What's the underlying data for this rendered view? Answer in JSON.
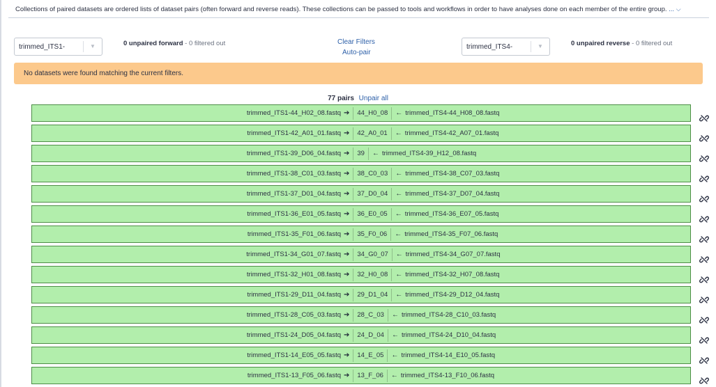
{
  "intro": {
    "text": "Collections of paired datasets are ordered lists of dataset pairs (often forward and reverse reads). These collections can be passed to tools and workflows in order to have analyses done on each member of the entire group.",
    "more": "...",
    "chevron_icon": "chevron-down-icon"
  },
  "forward": {
    "filter_value": "trimmed_ITS1-",
    "count_bold": "0 unpaired forward",
    "count_rest": " - 0 filtered out"
  },
  "reverse": {
    "filter_value": "trimmed_ITS4-",
    "count_bold": "0 unpaired reverse",
    "count_rest": " - 0 filtered out"
  },
  "actions": {
    "clear_filters": "Clear Filters",
    "auto_pair": "Auto-pair"
  },
  "warning": "No datasets were found matching the current filters.",
  "pairs_header": {
    "count": "77 pairs",
    "unpair_all": "Unpair all"
  },
  "colors": {
    "pair_bg": "#b2eeac",
    "pair_border": "#4d8e46",
    "warning_bg": "#fcc98c",
    "link": "#2c5fa8"
  },
  "pairs": [
    {
      "forward": "trimmed_ITS1-44_H02_08.fastq",
      "name": "44_H0_08",
      "reverse": "trimmed_ITS4-44_H08_08.fastq"
    },
    {
      "forward": "trimmed_ITS1-42_A01_01.fastq",
      "name": "42_A0_01",
      "reverse": "trimmed_ITS4-42_A07_01.fastq"
    },
    {
      "forward": "trimmed_ITS1-39_D06_04.fastq",
      "name": "39",
      "reverse": "trimmed_ITS4-39_H12_08.fastq"
    },
    {
      "forward": "trimmed_ITS1-38_C01_03.fastq",
      "name": "38_C0_03",
      "reverse": "trimmed_ITS4-38_C07_03.fastq"
    },
    {
      "forward": "trimmed_ITS1-37_D01_04.fastq",
      "name": "37_D0_04",
      "reverse": "trimmed_ITS4-37_D07_04.fastq"
    },
    {
      "forward": "trimmed_ITS1-36_E01_05.fastq",
      "name": "36_E0_05",
      "reverse": "trimmed_ITS4-36_E07_05.fastq"
    },
    {
      "forward": "trimmed_ITS1-35_F01_06.fastq",
      "name": "35_F0_06",
      "reverse": "trimmed_ITS4-35_F07_06.fastq"
    },
    {
      "forward": "trimmed_ITS1-34_G01_07.fastq",
      "name": "34_G0_07",
      "reverse": "trimmed_ITS4-34_G07_07.fastq"
    },
    {
      "forward": "trimmed_ITS1-32_H01_08.fastq",
      "name": "32_H0_08",
      "reverse": "trimmed_ITS4-32_H07_08.fastq"
    },
    {
      "forward": "trimmed_ITS1-29_D11_04.fastq",
      "name": "29_D1_04",
      "reverse": "trimmed_ITS4-29_D12_04.fastq"
    },
    {
      "forward": "trimmed_ITS1-28_C05_03.fastq",
      "name": "28_C_03",
      "reverse": "trimmed_ITS4-28_C10_03.fastq"
    },
    {
      "forward": "trimmed_ITS1-24_D05_04.fastq",
      "name": "24_D_04",
      "reverse": "trimmed_ITS4-24_D10_04.fastq"
    },
    {
      "forward": "trimmed_ITS1-14_E05_05.fastq",
      "name": "14_E_05",
      "reverse": "trimmed_ITS4-14_E10_05.fastq"
    },
    {
      "forward": "trimmed_ITS1-13_F05_06.fastq",
      "name": "13_F_06",
      "reverse": "trimmed_ITS4-13_F10_06.fastq"
    }
  ]
}
